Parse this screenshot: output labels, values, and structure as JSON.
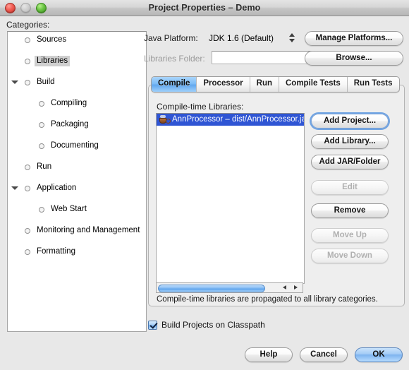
{
  "window": {
    "title": "Project Properties – Demo",
    "traffic_lights": [
      "close-button",
      "minimize-button",
      "zoom-button"
    ]
  },
  "sidebar": {
    "label": "Categories:",
    "items": [
      {
        "label": "Sources",
        "indent": 1,
        "twisty": "",
        "selected": false
      },
      {
        "label": "Libraries",
        "indent": 1,
        "twisty": "",
        "selected": true
      },
      {
        "label": "Build",
        "indent": 1,
        "twisty": "open",
        "selected": false
      },
      {
        "label": "Compiling",
        "indent": 2,
        "twisty": "",
        "selected": false
      },
      {
        "label": "Packaging",
        "indent": 2,
        "twisty": "",
        "selected": false
      },
      {
        "label": "Documenting",
        "indent": 2,
        "twisty": "",
        "selected": false
      },
      {
        "label": "Run",
        "indent": 1,
        "twisty": "",
        "selected": false
      },
      {
        "label": "Application",
        "indent": 1,
        "twisty": "open",
        "selected": false
      },
      {
        "label": "Web Start",
        "indent": 2,
        "twisty": "",
        "selected": false
      },
      {
        "label": "Monitoring and Management",
        "indent": 1,
        "twisty": "",
        "selected": false
      },
      {
        "label": "Formatting",
        "indent": 1,
        "twisty": "",
        "selected": false
      }
    ]
  },
  "platform": {
    "label": "Java Platform:",
    "value": "JDK 1.6 (Default)",
    "manage_button": "Manage Platforms..."
  },
  "libraries_folder": {
    "label": "Libraries Folder:",
    "value": "",
    "placeholder": "",
    "browse_button": "Browse..."
  },
  "tabs": [
    {
      "label": "Compile",
      "active": true
    },
    {
      "label": "Processor",
      "active": false
    },
    {
      "label": "Run",
      "active": false
    },
    {
      "label": "Compile Tests",
      "active": false
    },
    {
      "label": "Run Tests",
      "active": false
    }
  ],
  "list": {
    "caption": "Compile-time Libraries:",
    "rows": [
      {
        "label": "AnnProcessor – dist/AnnProcessor.jar",
        "icon": "jar-icon",
        "selected": true
      }
    ],
    "hint": "Compile-time libraries are propagated to all library categories."
  },
  "list_buttons": [
    {
      "label": "Add Project...",
      "name": "add-project-button",
      "enabled": true,
      "focused": true
    },
    {
      "label": "Add Library...",
      "name": "add-library-button",
      "enabled": true,
      "focused": false
    },
    {
      "label": "Add JAR/Folder",
      "name": "add-jar-folder-button",
      "enabled": true,
      "focused": false
    },
    {
      "label": "Edit",
      "name": "edit-button",
      "enabled": false,
      "focused": false
    },
    {
      "label": "Remove",
      "name": "remove-button",
      "enabled": true,
      "focused": false
    },
    {
      "label": "Move Up",
      "name": "move-up-button",
      "enabled": false,
      "focused": false
    },
    {
      "label": "Move Down",
      "name": "move-down-button",
      "enabled": false,
      "focused": false
    }
  ],
  "checkbox": {
    "label": "Build Projects on Classpath",
    "checked": true
  },
  "footer": {
    "help_label": "Help",
    "cancel_label": "Cancel",
    "ok_label": "OK"
  },
  "colors": {
    "selection_blue": "#2f55d4",
    "tab_active_blue": "#7ebdf6",
    "default_button_blue": "#a6cdf6",
    "window_bg": "#e8e8e8"
  }
}
